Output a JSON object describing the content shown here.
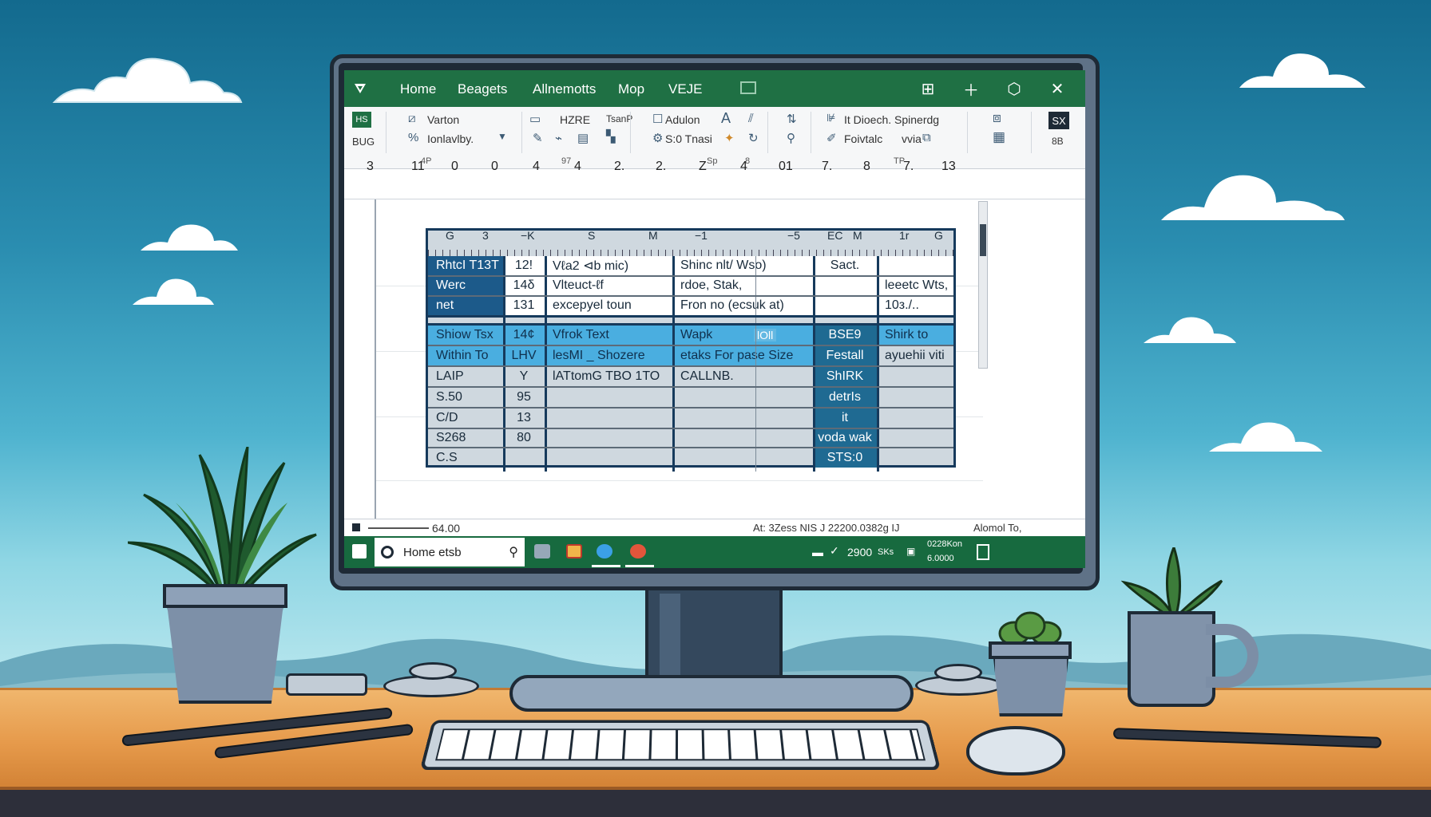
{
  "titlebar": {
    "menu": [
      "Home",
      "Beagets",
      "Allnemotts",
      "Mop",
      "VEJE"
    ]
  },
  "ribbon": {
    "g1_top": "HS",
    "g1_bottom": "BUG",
    "g2_line1": "Varton",
    "g2_line2": "Ionlavlby.",
    "g3_line1": "HZRE",
    "g3_line1b": "TsanP",
    "g4_line1": "Adulon",
    "g4_line2": "S:0 Tnasi",
    "g5_line1": "It Dioech. Spinerdg",
    "g5_line2": "Foivtalc",
    "g5_line2b": "vvia",
    "g6_label": "SX",
    "g6_small": "8B",
    "foot_labels": [
      "4P",
      "97",
      "Sp",
      "8",
      "TP"
    ]
  },
  "ruler": {
    "numbers": [
      "3",
      "11",
      "0",
      "0",
      "4",
      "4",
      "2.",
      "2.",
      "Z",
      "4",
      "01",
      "7.",
      "8",
      "7.",
      "13"
    ]
  },
  "table": {
    "col_heads": [
      "G",
      "3",
      "−K",
      "S",
      "M",
      "−1",
      "−5",
      "EC",
      "M",
      "1r",
      "G"
    ],
    "rows": [
      [
        "RhtcI T13T",
        "12!",
        "Vℓa2 ⊲b mic)",
        "Shinc nlt/ Wso)",
        "Sact.",
        ""
      ],
      [
        "Werc",
        "14δ",
        "Vlteuct-ℓf",
        "rdoe, Stak,",
        "",
        "leeetc Wts,"
      ],
      [
        "net",
        "131",
        "excepyel toun",
        "Fron no (ecsuk at)",
        "",
        "10з./.."
      ],
      [
        "Shiow Tsx",
        "14¢",
        "Vfrok Text",
        "Wapk",
        "BSE9",
        "Shirk to"
      ],
      [
        "Within To",
        "LHV",
        "lesMI _ Shozere",
        "etaks For pase Size",
        "Festall",
        "ayuehii viti"
      ],
      [
        "LAIP",
        "Y",
        "lATtomG TBO 1TO",
        "CALLNB.",
        "ShIRK",
        ""
      ],
      [
        "S.50",
        "95",
        "",
        "",
        "detrIs",
        ""
      ],
      [
        "C/D",
        "13",
        "",
        "",
        "it",
        ""
      ],
      [
        "S268",
        "80",
        "",
        "",
        "voda wak",
        ""
      ],
      [
        "C.S",
        "",
        "",
        "",
        "STS:0",
        ""
      ]
    ],
    "inline_badge": "lOll"
  },
  "statusbar": {
    "zoom": "64.00",
    "right_text": "At: 3Zess  NIS  J  22200.0382g  IJ",
    "right_end": "Alomol To,"
  },
  "taskbar": {
    "search_text": "Home etsb",
    "right_value": "2900",
    "right_unit": "SKs",
    "clock_line1": "0228Kon",
    "clock_line2": "6.0000"
  },
  "colors": {
    "title_green": "#1f7044",
    "header_blue": "#1c5a8a",
    "highlight_blue": "#4aaee0",
    "table_border": "#163a5c"
  },
  "icons": {
    "app": "diamond-logo-icon",
    "restore": "grid-icon",
    "add": "plus-icon",
    "sync": "hexagon-icon",
    "close": "close-icon",
    "search": "search-icon"
  }
}
